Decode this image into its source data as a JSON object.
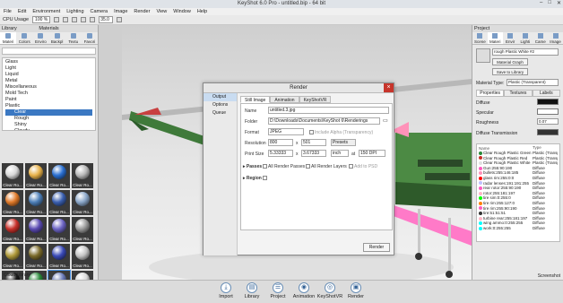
{
  "app": {
    "title": "KeyShot 6.0 Pro - untitled.bip - 64 bit"
  },
  "menu": [
    "File",
    "Edit",
    "Environment",
    "Lighting",
    "Camera",
    "Image",
    "Render",
    "View",
    "Window",
    "Help"
  ],
  "toolbar": {
    "cpu_label": "CPU Usage",
    "cpu_value": "100 %",
    "fov_value": "35.0"
  },
  "library": {
    "header": "Library",
    "panel_title": "Materials",
    "tabs": [
      "Materi",
      "Colors",
      "Enviro",
      "Backpl",
      "Textu",
      "Favori"
    ],
    "tree": [
      {
        "label": "Glass",
        "level": 0
      },
      {
        "label": "Light",
        "level": 0
      },
      {
        "label": "Liquid",
        "level": 0
      },
      {
        "label": "Metal",
        "level": 0
      },
      {
        "label": "Miscellaneous",
        "level": 0
      },
      {
        "label": "Mold Tech",
        "level": 0
      },
      {
        "label": "Paint",
        "level": 0
      },
      {
        "label": "Plastic",
        "level": 0
      },
      {
        "label": "Clear",
        "level": 1,
        "selected": true
      },
      {
        "label": "Rough",
        "level": 1
      },
      {
        "label": "Shiny",
        "level": 1
      },
      {
        "label": "Cloudy",
        "level": 1
      }
    ],
    "thumbs": [
      {
        "label": "Clear Ro...",
        "color": "#d9d9d9"
      },
      {
        "label": "Clear Ro...",
        "color": "#e8b24a"
      },
      {
        "label": "Clear Ro...",
        "color": "#2a6fd1"
      },
      {
        "label": "Clear Ro...",
        "color": "#b8b8b8"
      },
      {
        "label": "Clear Ro...",
        "color": "#e07a2a"
      },
      {
        "label": "Clear Ro...",
        "color": "#4d7fb8"
      },
      {
        "label": "Clear Ro...",
        "color": "#3a5fb0"
      },
      {
        "label": "Clear Ro...",
        "color": "#8aa6c8"
      },
      {
        "label": "Clear Ro...",
        "color": "#c8302a"
      },
      {
        "label": "Clear Ro...",
        "color": "#5a4ab2"
      },
      {
        "label": "Clear Ro...",
        "color": "#6c64c4"
      },
      {
        "label": "Clear Ro...",
        "color": "#9a9a9a"
      },
      {
        "label": "Clear Ro...",
        "color": "#b09a3a"
      },
      {
        "label": "Clear Ro...",
        "color": "#7a6a2a"
      },
      {
        "label": "Clear Ro...",
        "color": "#3a4ab8"
      },
      {
        "label": "Clear Ro...",
        "color": "#c4c4c4"
      },
      {
        "label": "Clear Ro...",
        "color": "#1a1a1a"
      },
      {
        "label": "Clear Shi...",
        "color": "#2a8a3a"
      },
      {
        "label": "Clear Shi...",
        "color": "#6a7ab8",
        "selected": true
      },
      {
        "label": "Clear Shi...",
        "color": "#d8d8d8"
      }
    ],
    "footer": "Cloud Library"
  },
  "dialog": {
    "title": "Render",
    "side": [
      "Output",
      "Options",
      "Queue"
    ],
    "tabs": [
      "Still Image",
      "Animation",
      "KeyShotVR"
    ],
    "name_label": "Name",
    "name_value": "untitled.3.jpg",
    "folder_label": "Folder",
    "folder_value": "D:\\Downloads\\Documents\\KeyShot 6\\Renderings",
    "format_label": "Format",
    "format_value": "JPEG",
    "alpha_label": "Include Alpha (Transparency)",
    "resolution_label": "Resolution",
    "res_w": "800",
    "res_x": "x",
    "res_h": "501",
    "presets": "Presets",
    "print_label": "Print Size",
    "print_w": "5.33333",
    "print_x": "x",
    "print_h": "3.67333",
    "print_unit": "inch",
    "print_at": "at",
    "print_dpi": "150 DPI",
    "passes_label": "Passes",
    "all_passes": "All Render Passes",
    "all_layers": "All Render Layers",
    "add_psd": "Add to PSD",
    "region_label": "Region",
    "render_button": "Render"
  },
  "material": {
    "header": "Project",
    "tabs": [
      "Scene",
      "Materi",
      "Envir",
      "Lighti",
      "Came",
      "Image"
    ],
    "name": "rough Plastic White #2",
    "graph_button": "Material Graph",
    "save_button": "Save to Library",
    "type_label": "Material Type:",
    "type_value": "Plastic (Transparent)",
    "sub_tabs": [
      "Properties",
      "Textures",
      "Labels"
    ],
    "props": [
      {
        "label": "Diffuse",
        "value": ""
      },
      {
        "label": "Specular",
        "value": ""
      },
      {
        "label": "Roughness",
        "value": "0.07"
      },
      {
        "label": "Diffuse Transmission",
        "value": ""
      }
    ],
    "list_headers": [
      "Name",
      "Type"
    ],
    "list": [
      {
        "name": "Clear Rough Plastic Green",
        "type": "Plastic (Transp",
        "color": "#2a8a3a"
      },
      {
        "name": "Clear Rough Plastic Red",
        "type": "Plastic (Transp",
        "color": "#c8302a"
      },
      {
        "name": "Clear Rough Plastic White",
        "type": "Plastic (Transp",
        "color": "#e0e0e0"
      },
      {
        "name": "Gun:255:90:190",
        "type": "Diffuse",
        "color": "#ff5abe"
      },
      {
        "name": "bullets:255:146:185",
        "type": "Diffuse",
        "color": "#ff92b9"
      },
      {
        "name": "glass rim:255:0:0",
        "type": "Diffuse",
        "color": "#ff0000"
      },
      {
        "name": "radar lenses:191:191:255",
        "type": "Diffuse",
        "color": "#bfbfff"
      },
      {
        "name": "rear rotor:255:90:190",
        "type": "Diffuse",
        "color": "#ff5abe"
      },
      {
        "name": "rotor:255:181:197",
        "type": "Diffuse",
        "color": "#ffb5c5"
      },
      {
        "name": "tire sim:0:255:0",
        "type": "Diffuse",
        "color": "#00ff00"
      },
      {
        "name": "tire rim:255:127:0",
        "type": "Diffuse",
        "color": "#ff7f00"
      },
      {
        "name": "tire rim:255:90:190",
        "type": "Diffuse",
        "color": "#ff5abe"
      },
      {
        "name": "tire:51:51:51",
        "type": "Diffuse",
        "color": "#333333"
      },
      {
        "name": "turbine rear:255:181:197",
        "type": "Diffuse",
        "color": "#ffb5c5"
      },
      {
        "name": "wing ammo:0:255:255",
        "type": "Diffuse",
        "color": "#00ffff"
      },
      {
        "name": "work:0:255:255",
        "type": "Diffuse",
        "color": "#00ffff"
      }
    ]
  },
  "bottom": [
    {
      "label": "Import",
      "icon": "import-icon",
      "glyph": "⤓"
    },
    {
      "label": "Library",
      "icon": "library-icon",
      "glyph": "▤"
    },
    {
      "label": "Project",
      "icon": "project-icon",
      "glyph": "☰"
    },
    {
      "label": "Animation",
      "icon": "animation-icon",
      "glyph": "◉"
    },
    {
      "label": "KeyShotVR",
      "icon": "keyshotvr-icon",
      "glyph": "◎"
    },
    {
      "label": "Render",
      "icon": "render-icon",
      "glyph": "▣"
    }
  ],
  "bottom_right": "Screenshot"
}
